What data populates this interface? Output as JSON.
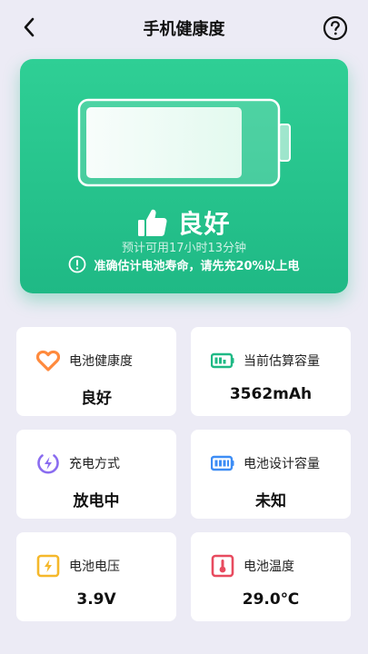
{
  "header": {
    "title": "手机健康度"
  },
  "hero": {
    "battery_level": 0.84,
    "verdict": "良好",
    "estimate": "预计可用17小时13分钟",
    "notice": "准确估计电池寿命，请先充20%以上电"
  },
  "cards": [
    {
      "label": "电池健康度",
      "value": "良好",
      "icon": "heart-icon",
      "color": "#ff8a3d"
    },
    {
      "label": "当前估算容量",
      "value": "3562mAh",
      "icon": "battery-capacity-icon",
      "color": "#1fb985"
    },
    {
      "label": "充电方式",
      "value": "放电中",
      "icon": "charging-icon",
      "color": "#8a6cf0"
    },
    {
      "label": "电池设计容量",
      "value": "未知",
      "icon": "battery-design-icon",
      "color": "#3d8df5"
    },
    {
      "label": "电池电压",
      "value": "3.9V",
      "icon": "voltage-icon",
      "color": "#f5b82b"
    },
    {
      "label": "电池温度",
      "value": "29.0℃",
      "icon": "thermometer-icon",
      "color": "#e84b5f"
    }
  ]
}
